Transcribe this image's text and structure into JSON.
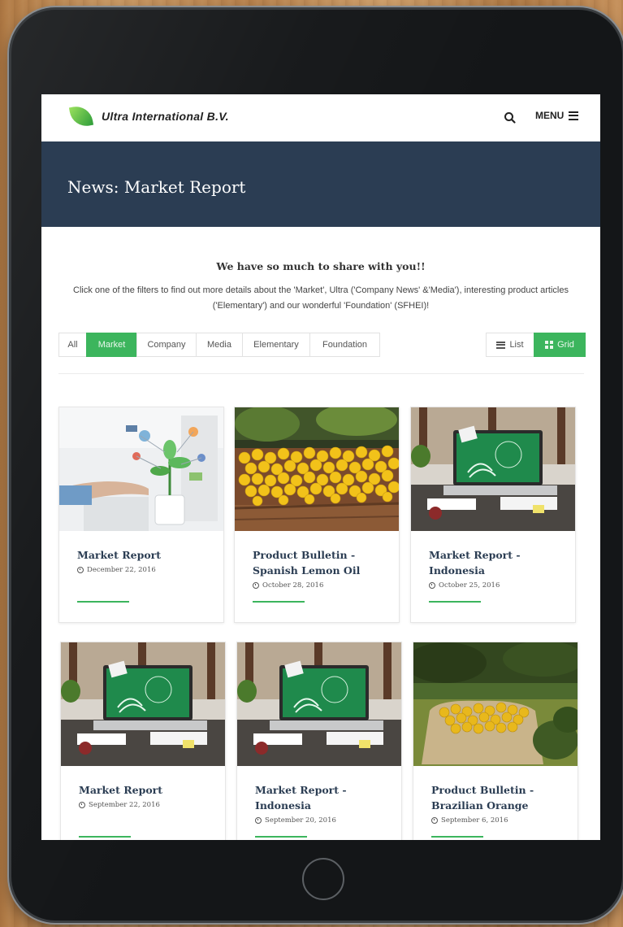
{
  "header": {
    "brand": "Ultra International B.V.",
    "menu_label": "MENU"
  },
  "banner": {
    "title": "News: Market Report"
  },
  "intro": {
    "heading": "We have so much to share with you!!",
    "text": "Click one of the filters to find out more details about the 'Market', Ultra ('Company News' &'Media'), interesting product articles ('Elementary') and our wonderful 'Foundation' (SFHEI)!"
  },
  "filters": [
    {
      "label": "All",
      "active": false
    },
    {
      "label": "Market",
      "active": true
    },
    {
      "label": "Company",
      "active": false
    },
    {
      "label": "Media",
      "active": false
    },
    {
      "label": "Elementary",
      "active": false
    },
    {
      "label": "Foundation",
      "active": false
    }
  ],
  "view": {
    "list_label": "List",
    "grid_label": "Grid",
    "selected": "Grid"
  },
  "cards": [
    {
      "title": "Market Report",
      "date": "December 22, 2016",
      "image": "hand-plant-illustration"
    },
    {
      "title": "Product Bulletin - Spanish Lemon Oil",
      "date": "October 28, 2016",
      "image": "lemons-crate"
    },
    {
      "title": "Market Report - Indonesia",
      "date": "October 25, 2016",
      "image": "laptop-desk"
    },
    {
      "title": "Market Report",
      "date": "September 22, 2016",
      "image": "laptop-desk"
    },
    {
      "title": "Market Report - Indonesia",
      "date": "September 20, 2016",
      "image": "laptop-desk"
    },
    {
      "title": "Product Bulletin - Brazilian Orange",
      "date": "September 6, 2016",
      "image": "oranges-sack"
    }
  ],
  "colors": {
    "banner": "#2b3d53",
    "accent": "#3cb55d",
    "title": "#2b3d53"
  }
}
